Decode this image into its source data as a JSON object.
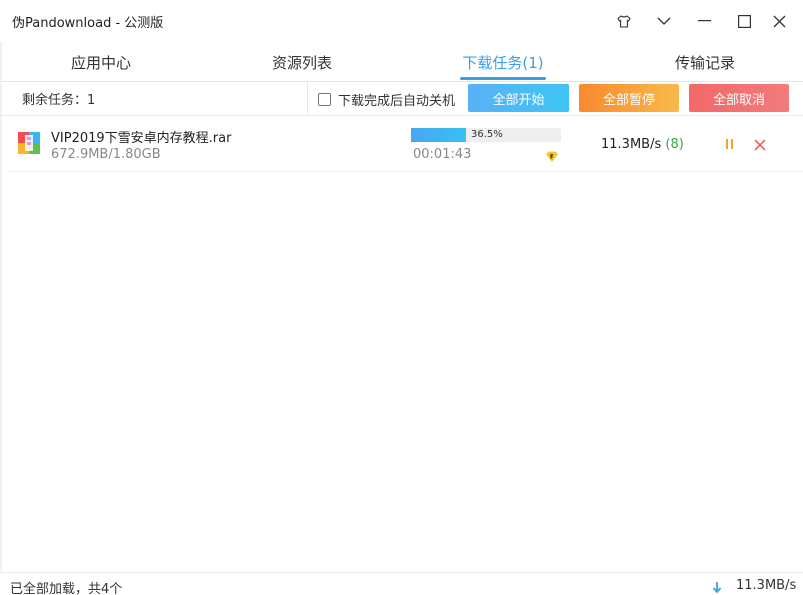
{
  "window": {
    "title": "伪Pandownload - 公测版",
    "icons": [
      "skin-icon",
      "chevron-down-icon",
      "minimize-icon",
      "maximize-icon",
      "close-icon"
    ]
  },
  "tabs": [
    {
      "label": "应用中心",
      "active": false
    },
    {
      "label": "资源列表",
      "active": false
    },
    {
      "label": "下载任务(1)",
      "active": true
    },
    {
      "label": "传输记录",
      "active": false
    }
  ],
  "toolbar": {
    "remaining_label": "剩余任务：1",
    "shutdown_label": "下载完成后自动关机",
    "shutdown_checked": false,
    "start_all": "全部开始",
    "pause_all": "全部暂停",
    "cancel_all": "全部取消"
  },
  "tasks": [
    {
      "name": "VIP2019下雪安卓内存教程.rar",
      "size": "672.9MB/1.80GB",
      "progress_percent": 36.5,
      "progress_label": "36.5%",
      "elapsed": "00:01:43",
      "speed": "11.3MB/s",
      "connections": "(8)",
      "file_icon": "archive-file-icon",
      "vip_icon": "vip-badge-icon"
    }
  ],
  "status": {
    "text": "已全部加载，共4个",
    "speed": "11.3MB/s",
    "icon": "download-arrow-icon"
  },
  "colors": {
    "accent": "#3aa0e8",
    "start": "#4fb3f6",
    "pause": "#f79b35",
    "cancel": "#f36b6b",
    "connections": "#3aa63a"
  }
}
